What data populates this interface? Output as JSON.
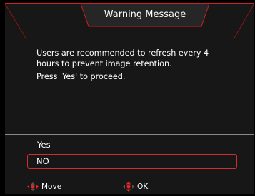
{
  "dialog": {
    "title": "Warning Message",
    "message_line1": "Users are recommended to refresh every 4",
    "message_line2": "hours to prevent image retention.",
    "message_line3": "Press 'Yes' to proceed."
  },
  "options": [
    {
      "label": "Yes",
      "selected": false
    },
    {
      "label": "NO",
      "selected": true
    }
  ],
  "footer": {
    "move_label": "Move",
    "ok_label": "OK",
    "move_icon": "dpad-left-right-icon",
    "ok_icon": "dpad-up-down-icon"
  },
  "colors": {
    "accent": "#d22c2c",
    "background": "#171717",
    "title_tab": "#262626",
    "text": "#ffffff"
  }
}
